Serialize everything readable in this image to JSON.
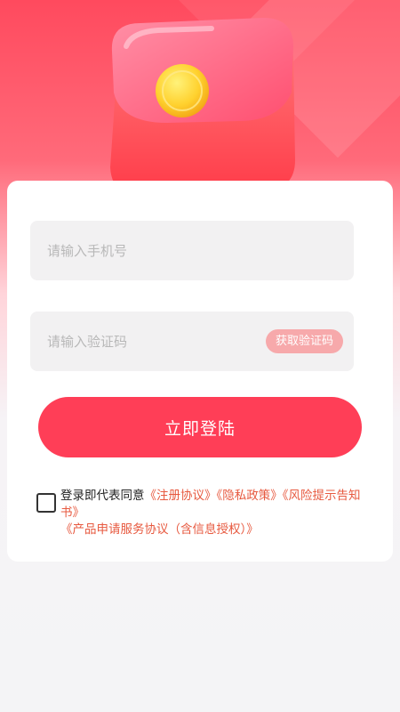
{
  "colors": {
    "brand": "#ff3e57",
    "link": "#e7593f",
    "get_code_bg": "#f7a9ab",
    "wallet_red": "#ff5a62",
    "coin_gold": "#ffd23a"
  },
  "icons": {
    "hero": "red-packet-wallet-icon"
  },
  "form": {
    "phone_placeholder": "请输入手机号",
    "phone_value": "",
    "code_placeholder": "请输入验证码",
    "code_value": "",
    "get_code_label": "获取验证码",
    "login_label": "立即登陆"
  },
  "agreement": {
    "checked": false,
    "prefix": "登录即代表同意",
    "links": [
      "《注册协议》",
      "《隐私政策》",
      "《风险提示告知书》",
      "《产品申请服务协议（含信息授权）》"
    ]
  }
}
